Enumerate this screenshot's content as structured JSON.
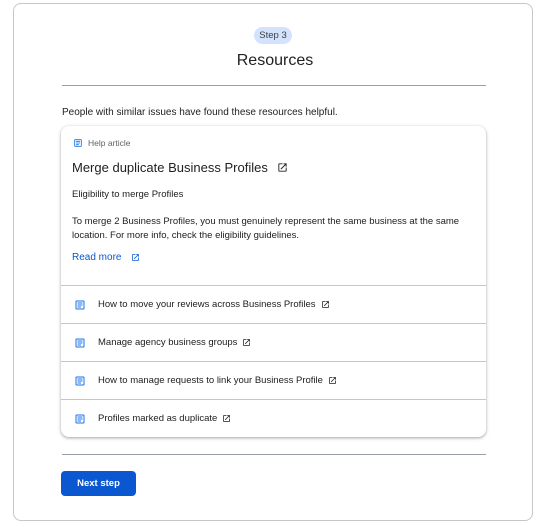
{
  "header": {
    "step_badge": "Step 3",
    "title": "Resources"
  },
  "intro_text": "People with similar issues have found these resources helpful.",
  "featured": {
    "type_label": "Help article",
    "title": "Merge duplicate Business Profiles",
    "subtitle": "Eligibility to merge Profiles",
    "description": "To merge 2 Business Profiles, you must genuinely represent the same business at the same location. For more info, check the eligibility guidelines.",
    "read_more": "Read more"
  },
  "resources": [
    {
      "label": "How to move your reviews across Business Profiles"
    },
    {
      "label": "Manage agency business groups"
    },
    {
      "label": "How to manage requests to link your Business Profile"
    },
    {
      "label": "Profiles marked as duplicate"
    }
  ],
  "actions": {
    "next_label": "Next step"
  },
  "colors": {
    "accent": "#0b57d0",
    "badge_bg": "#d3e3fd",
    "icon": "#1a73e8"
  },
  "icons": {
    "article": "doc-icon",
    "external": "open-in-new-icon"
  }
}
